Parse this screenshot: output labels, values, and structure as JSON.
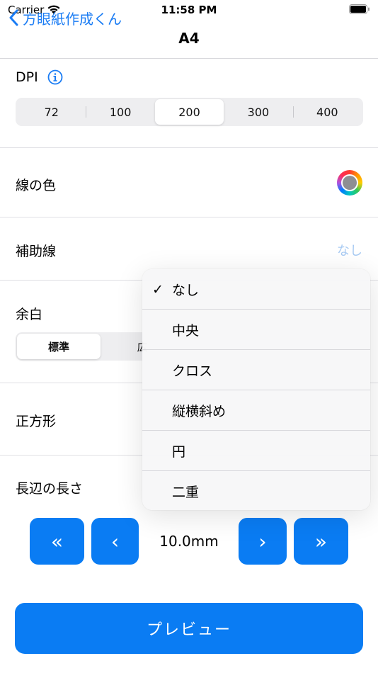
{
  "status": {
    "carrier": "Carrier",
    "time": "11:58 PM"
  },
  "nav": {
    "back_label": "方眼紙作成くん",
    "title": "A4"
  },
  "dpi": {
    "label": "DPI",
    "options": [
      "72",
      "100",
      "200",
      "300",
      "400"
    ],
    "selected": "200"
  },
  "line_color": {
    "label": "線の色",
    "swatch_color": "#8e8e93"
  },
  "guide": {
    "label": "補助線",
    "value": "なし"
  },
  "margin": {
    "label": "余白",
    "options": [
      "標準",
      "広"
    ],
    "selected": "標準"
  },
  "square": {
    "label": "正方形"
  },
  "long_side": {
    "label": "長辺の長さ",
    "value": "10.0mm",
    "fast_back": "«",
    "back": "‹",
    "forward": "›",
    "fast_forward": "»"
  },
  "preview_label": "プレビュー",
  "menu": {
    "items": [
      {
        "label": "なし",
        "checked": true
      },
      {
        "label": "中央",
        "checked": false
      },
      {
        "label": "クロス",
        "checked": false
      },
      {
        "label": "縦横斜め",
        "checked": false
      },
      {
        "label": "円",
        "checked": false
      },
      {
        "label": "二重",
        "checked": false
      }
    ],
    "check_glyph": "✓"
  },
  "colors": {
    "accent": "#0a7cf3",
    "link": "#1a7cf4"
  }
}
